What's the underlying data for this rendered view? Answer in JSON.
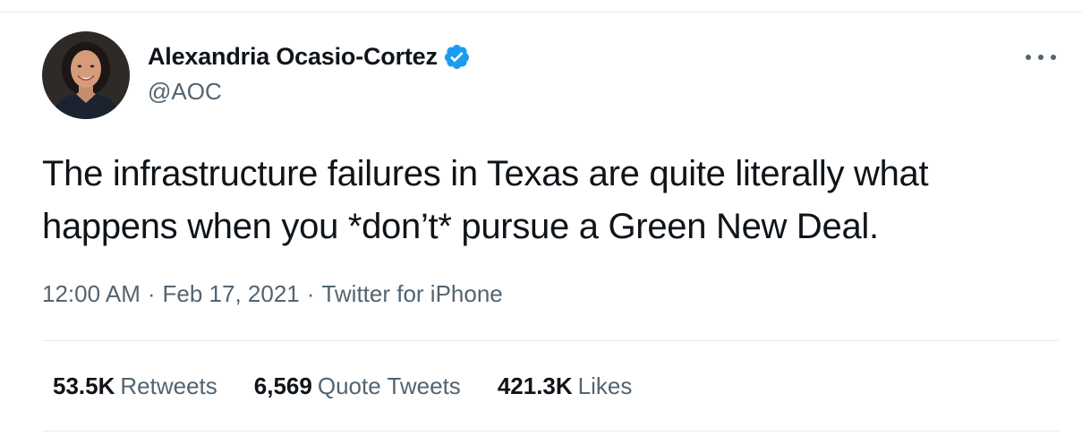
{
  "author": {
    "display_name": "Alexandria Ocasio-Cortez",
    "handle": "@AOC",
    "verified": true,
    "avatar_icon": "profile-photo"
  },
  "tweet": {
    "text": "The infrastructure failures in Texas are quite literally what\nhappens when you *don’t* pursue a Green New Deal."
  },
  "meta": {
    "time": "12:00 AM",
    "separator": "·",
    "date": "Feb 17, 2021",
    "source": "Twitter for iPhone"
  },
  "stats": [
    {
      "value": "53.5K",
      "label": "Retweets"
    },
    {
      "value": "6,569",
      "label": "Quote Tweets"
    },
    {
      "value": "421.3K",
      "label": "Likes"
    }
  ],
  "icons": {
    "verified_badge": "verified-check-icon",
    "more_menu": "more-horizontal-icon"
  },
  "colors": {
    "text_primary": "#0f1419",
    "text_secondary": "#536471",
    "verified_blue": "#1d9bf0",
    "divider": "#e6ecf0"
  }
}
